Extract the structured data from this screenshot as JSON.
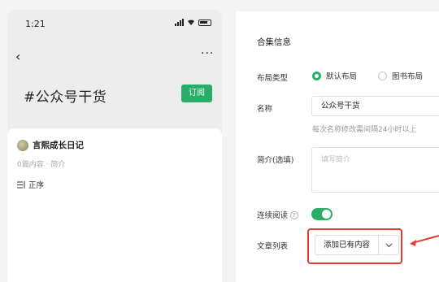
{
  "phone": {
    "time": "1:21",
    "back_glyph": "‹",
    "more_glyph": "···",
    "title": "#公众号干货",
    "subscribe_label": "订阅",
    "account_name": "言熙成长日记",
    "meta": "0篇内容 · 简介",
    "sort_label": "正序"
  },
  "panel": {
    "section_title": "合集信息",
    "layout_label": "布局类型",
    "layout_options": [
      "默认布局",
      "图书布局"
    ],
    "layout_selected": "默认布局",
    "name_label": "名称",
    "name_value": "公众号干货",
    "name_hint": "每次名称修改需间隔24小时以上",
    "intro_label": "简介(选填)",
    "intro_placeholder": "填写简介",
    "continuous_label": "连续阅读",
    "continuous_help": "?",
    "continuous_on": true,
    "article_list_label": "文章列表",
    "add_existing_label": "添加已有内容"
  },
  "colors": {
    "accent": "#2aae67",
    "highlight": "#e23b32"
  },
  "icons": [
    "back-icon",
    "more-icon",
    "signal-icon",
    "wifi-icon",
    "battery-icon",
    "sort-icon",
    "help-icon",
    "chevron-down-icon",
    "arrow-icon"
  ]
}
